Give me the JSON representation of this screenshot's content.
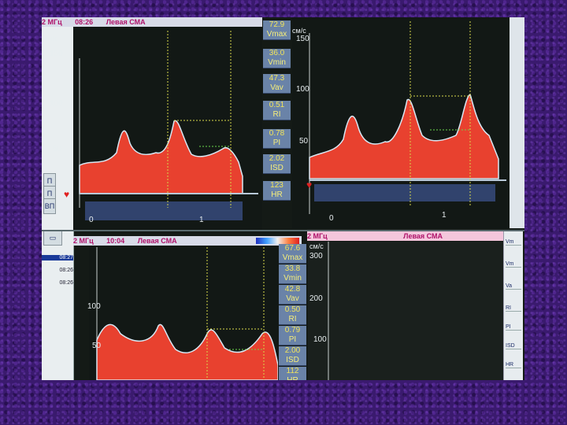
{
  "screen": {
    "left_sidebar": {
      "buttons": [
        "П",
        "П",
        "ВП"
      ],
      "times": [
        "08:27",
        "08:26",
        "08:26"
      ]
    },
    "panel_top_left": {
      "header": {
        "freq": "2 МГц",
        "time": "08:26",
        "side": "Левая СМА"
      },
      "unit": "см/с",
      "ticks": [
        "150",
        "100",
        "50",
        "0",
        "1"
      ],
      "readouts": [
        {
          "value": "72.9",
          "label": "Vmax"
        },
        {
          "value": "36.0",
          "label": "Vmin"
        },
        {
          "value": "47.3",
          "label": "Vav"
        },
        {
          "value": "0.51",
          "label": "RI"
        },
        {
          "value": "0.78",
          "label": "PI"
        },
        {
          "value": "2.02",
          "label": "ISD"
        },
        {
          "value": "123",
          "label": "HR"
        }
      ]
    },
    "panel_top_right": {
      "unit": "см/с",
      "ticks": [
        "150",
        "100",
        "50",
        "0",
        "1"
      ]
    },
    "panel_bottom_left": {
      "header": {
        "freq": "2 МГц",
        "time": "10:04",
        "side": "Левая СМА"
      },
      "unit": "см/с",
      "ticks": [
        "100",
        "50"
      ],
      "readouts": [
        {
          "value": "67.6",
          "label": "Vmax"
        },
        {
          "value": "33.8",
          "label": "Vmin"
        },
        {
          "value": "42.8",
          "label": "Vav"
        },
        {
          "value": "0.50",
          "label": "RI"
        },
        {
          "value": "0.79",
          "label": "PI"
        },
        {
          "value": "2.00",
          "label": "ISD"
        },
        {
          "value": "112",
          "label": "HR"
        }
      ]
    },
    "panel_bottom_right": {
      "header": {
        "freq": "2 МГц",
        "side": "Левая СМА"
      },
      "unit": "см/с",
      "ticks": [
        "300",
        "200",
        "100"
      ],
      "right_labels": [
        "Vm",
        "Vm",
        "Va",
        "RI",
        "PI",
        "ISD",
        "HR"
      ]
    }
  },
  "colors": {
    "spectrum_red": "#e8412f",
    "spectrum_blue": "#4a6fd0",
    "envelope": "#d8e8f4",
    "cursor_yellow": "#d8d84a",
    "cursor_green": "#6ad84a",
    "readout_bg": "#6a83a8",
    "readout_text": "#f2e45a",
    "header_text": "#b0126a"
  }
}
